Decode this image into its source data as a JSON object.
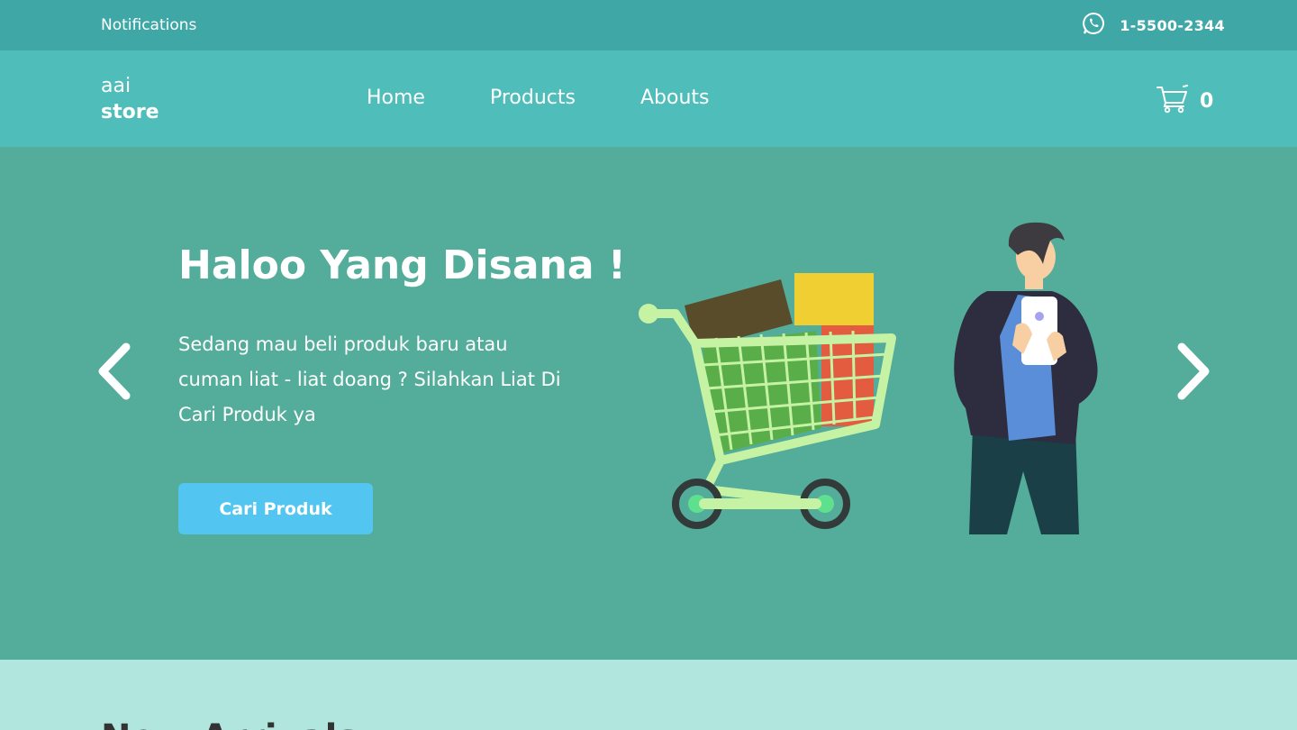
{
  "topbar": {
    "notifications_label": "Notifications",
    "phone_icon": "whatsapp-icon",
    "phone_number": "1-5500-2344"
  },
  "navbar": {
    "logo_line1": "aai",
    "logo_line2": "store",
    "menu": [
      "Home",
      "Products",
      "Abouts"
    ],
    "cart_icon": "cart-icon",
    "cart_count": "0"
  },
  "hero": {
    "title": "Haloo Yang Disana !",
    "description": "Sedang mau beli produk baru atau cuman liat - liat doang ? Silahkan Liat Di Cari Produk ya",
    "button_label": "Cari Produk",
    "prev_icon": "chevron-left-icon",
    "next_icon": "chevron-right-icon",
    "background": "#53ad9a",
    "button_color": "#52c5f0"
  },
  "section": {
    "title": "New Arrivals"
  },
  "colors": {
    "topbar": "#3fa8a6",
    "navbar": "#4fbdb9",
    "section_bg": "#b0e6dd"
  }
}
